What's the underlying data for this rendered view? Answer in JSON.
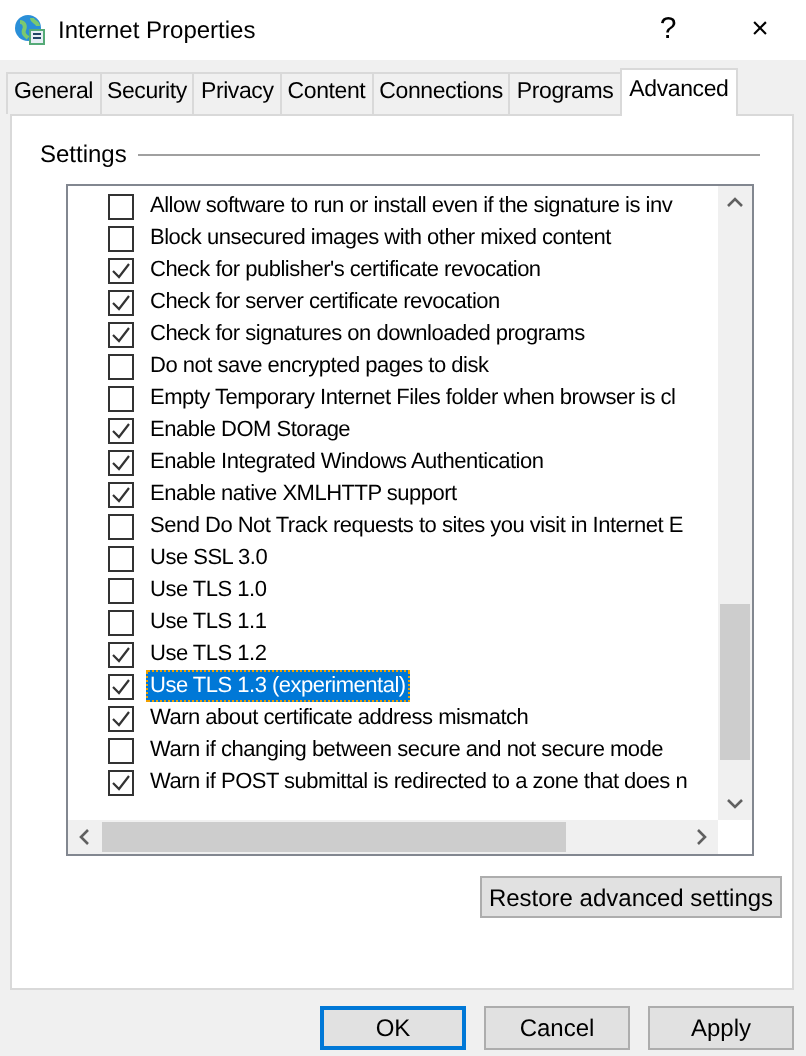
{
  "window": {
    "title": "Internet Properties",
    "help": "?",
    "close": "×"
  },
  "tabs": [
    {
      "label": "General",
      "selected": false
    },
    {
      "label": "Security",
      "selected": false
    },
    {
      "label": "Privacy",
      "selected": false
    },
    {
      "label": "Content",
      "selected": false
    },
    {
      "label": "Connections",
      "selected": false
    },
    {
      "label": "Programs",
      "selected": false
    },
    {
      "label": "Advanced",
      "selected": true
    }
  ],
  "settings": {
    "title": "Settings",
    "items": [
      {
        "label": "Allow software to run or install even if the signature is inv",
        "checked": false,
        "selected": false
      },
      {
        "label": "Block unsecured images with other mixed content",
        "checked": false,
        "selected": false
      },
      {
        "label": "Check for publisher's certificate revocation",
        "checked": true,
        "selected": false
      },
      {
        "label": "Check for server certificate revocation",
        "checked": true,
        "selected": false
      },
      {
        "label": "Check for signatures on downloaded programs",
        "checked": true,
        "selected": false
      },
      {
        "label": "Do not save encrypted pages to disk",
        "checked": false,
        "selected": false
      },
      {
        "label": "Empty Temporary Internet Files folder when browser is cl",
        "checked": false,
        "selected": false
      },
      {
        "label": "Enable DOM Storage",
        "checked": true,
        "selected": false
      },
      {
        "label": "Enable Integrated Windows Authentication",
        "checked": true,
        "selected": false
      },
      {
        "label": "Enable native XMLHTTP support",
        "checked": true,
        "selected": false
      },
      {
        "label": "Send Do Not Track requests to sites you visit in Internet E",
        "checked": false,
        "selected": false
      },
      {
        "label": "Use SSL 3.0",
        "checked": false,
        "selected": false
      },
      {
        "label": "Use TLS 1.0",
        "checked": false,
        "selected": false
      },
      {
        "label": "Use TLS 1.1",
        "checked": false,
        "selected": false
      },
      {
        "label": "Use TLS 1.2",
        "checked": true,
        "selected": false
      },
      {
        "label": "Use TLS 1.3 (experimental)",
        "checked": true,
        "selected": true
      },
      {
        "label": "Warn about certificate address mismatch",
        "checked": true,
        "selected": false
      },
      {
        "label": "Warn if changing between secure and not secure mode",
        "checked": false,
        "selected": false
      },
      {
        "label": "Warn if POST submittal is redirected to a zone that does n",
        "checked": true,
        "selected": false
      }
    ]
  },
  "restore_button": "Restore advanced settings",
  "buttons": [
    {
      "label": "OK",
      "default": true
    },
    {
      "label": "Cancel",
      "default": false
    },
    {
      "label": "Apply",
      "default": false
    }
  ]
}
